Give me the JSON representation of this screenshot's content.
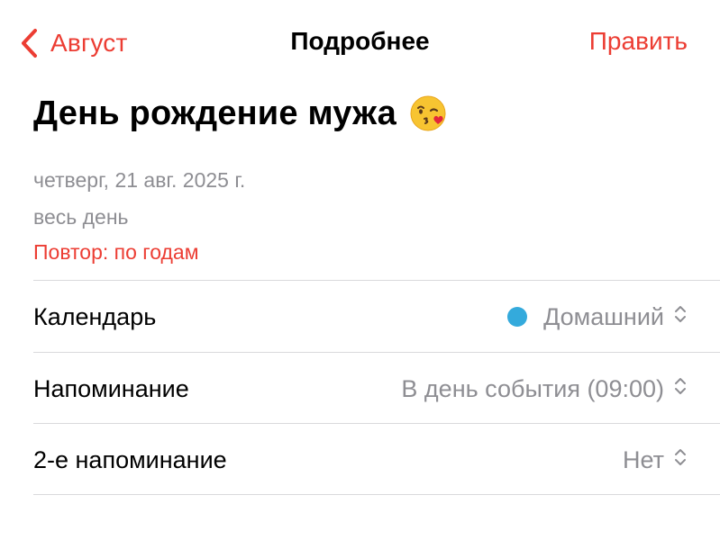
{
  "nav": {
    "back_label": "Август",
    "title": "Подробнее",
    "edit_label": "Править"
  },
  "event": {
    "title": "День рождение мужа",
    "title_emoji": "face-blowing-a-kiss-icon",
    "date": "четверг, 21 авг. 2025 г.",
    "all_day": "весь день",
    "repeat": "Повтор: по годам"
  },
  "rows": [
    {
      "label": "Календарь",
      "value": "Домашний",
      "dot_color": "#34aadc"
    },
    {
      "label": "Напоминание",
      "value": "В день события (09:00)"
    },
    {
      "label": "2-е напоминание",
      "value": "Нет"
    }
  ],
  "colors": {
    "accent": "#ec3d33",
    "secondary_text": "#8e8e93",
    "separator": "#d9d9dc",
    "calendar_dot": "#34aadc"
  }
}
